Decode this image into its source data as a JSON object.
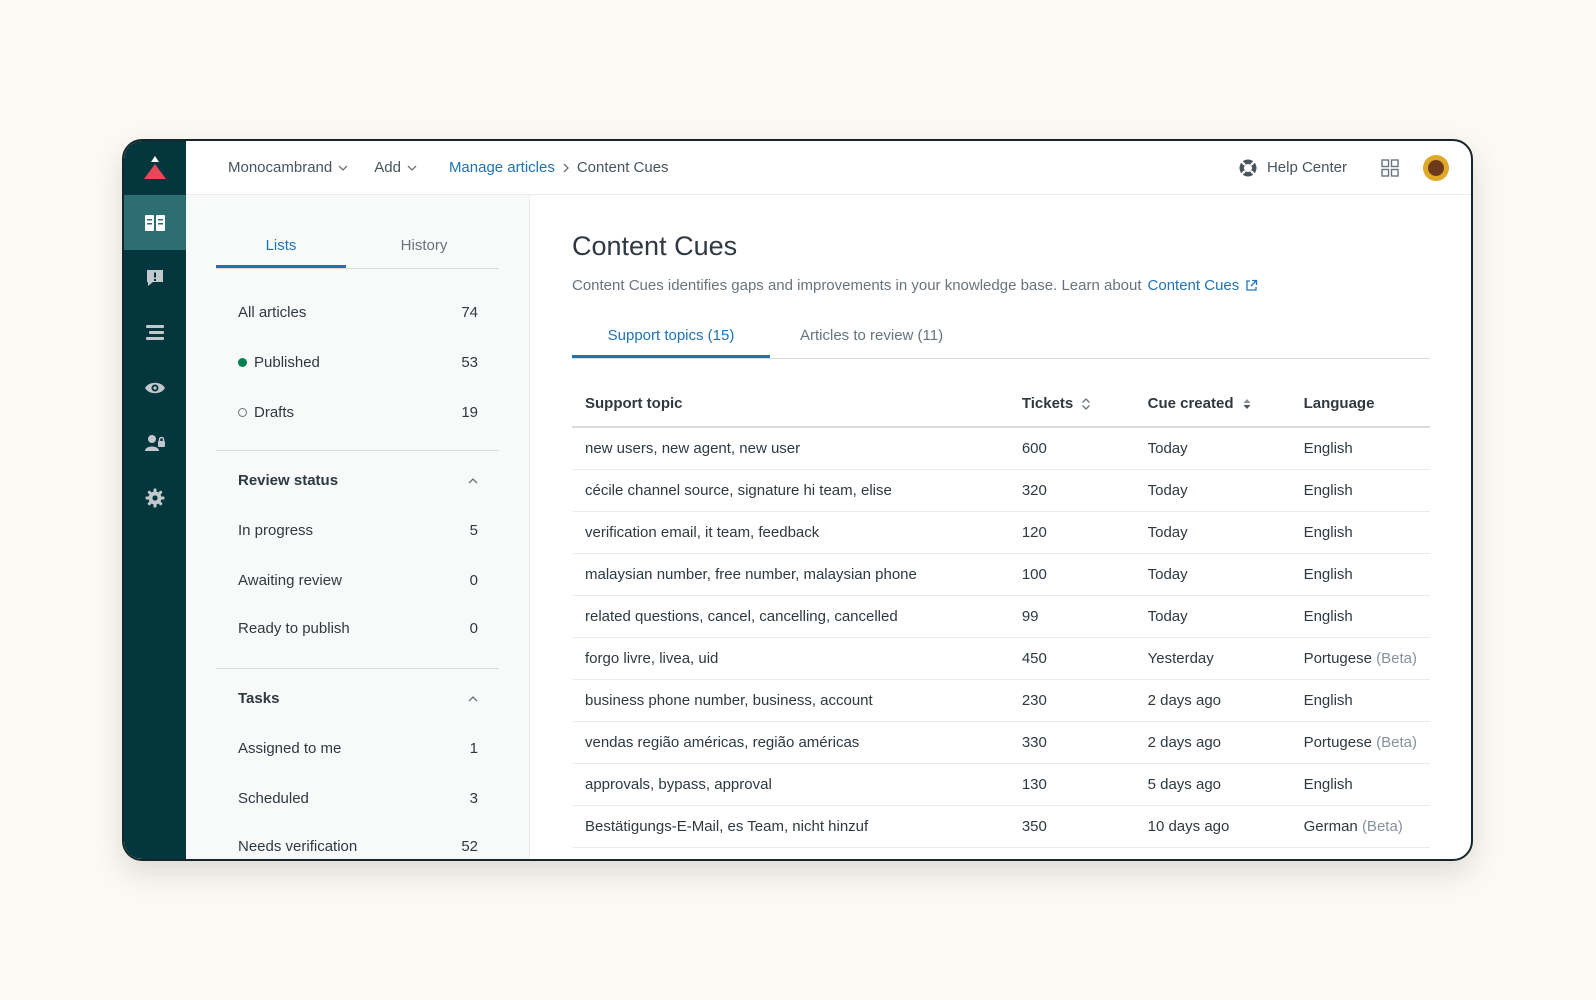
{
  "topbar": {
    "brand": "Monocambrand",
    "add": "Add",
    "crumb_link": "Manage articles",
    "crumb_current": "Content Cues",
    "help_center": "Help Center"
  },
  "rail": {
    "icons": [
      "guide-logo-icon",
      "knowledge-base-icon",
      "alert-icon",
      "list-icon",
      "eye-icon",
      "user-lock-icon",
      "gear-icon"
    ]
  },
  "sidepanel": {
    "tabs": [
      "Lists",
      "History"
    ],
    "lists": [
      {
        "label": "All articles",
        "count": "74"
      },
      {
        "label": "Published",
        "count": "53"
      },
      {
        "label": "Drafts",
        "count": "19"
      }
    ],
    "review_status": {
      "title": "Review status",
      "items": [
        {
          "label": "In progress",
          "count": "5"
        },
        {
          "label": "Awaiting review",
          "count": "0"
        },
        {
          "label": "Ready to publish",
          "count": "0"
        }
      ]
    },
    "tasks": {
      "title": "Tasks",
      "items": [
        {
          "label": "Assigned to me",
          "count": "1"
        },
        {
          "label": "Scheduled",
          "count": "3"
        },
        {
          "label": "Needs verification",
          "count": "52"
        }
      ]
    }
  },
  "main": {
    "title": "Content Cues",
    "description": "Content Cues identifies gaps and improvements in your knowledge base. Learn about",
    "description_link": "Content Cues",
    "tabs": [
      "Support topics (15)",
      "Articles to review (11)"
    ],
    "columns": [
      "Support topic",
      "Tickets",
      "Cue created",
      "Language"
    ],
    "rows": [
      {
        "topic": "new users, new agent, new user",
        "tickets": "600",
        "created": "Today",
        "language": "English",
        "beta": ""
      },
      {
        "topic": "cécile channel source, signature hi team, elise",
        "tickets": "320",
        "created": "Today",
        "language": "English",
        "beta": ""
      },
      {
        "topic": "verification email, it team, feedback",
        "tickets": "120",
        "created": "Today",
        "language": "English",
        "beta": ""
      },
      {
        "topic": "malaysian number, free number, malaysian phone",
        "tickets": "100",
        "created": "Today",
        "language": "English",
        "beta": ""
      },
      {
        "topic": "related questions, cancel, cancelling, cancelled",
        "tickets": "99",
        "created": "Today",
        "language": "English",
        "beta": ""
      },
      {
        "topic": "forgo livre, livea, uid",
        "tickets": "450",
        "created": "Yesterday",
        "language": "Portugese",
        "beta": "(Beta)"
      },
      {
        "topic": "business phone number, business, account",
        "tickets": "230",
        "created": "2 days ago",
        "language": "English",
        "beta": ""
      },
      {
        "topic": "vendas região américas, região américas",
        "tickets": "330",
        "created": "2 days ago",
        "language": "Portugese",
        "beta": "(Beta)"
      },
      {
        "topic": "approvals, bypass, approval",
        "tickets": "130",
        "created": "5 days ago",
        "language": "English",
        "beta": ""
      },
      {
        "topic": "Bestätigungs-E-Mail, es Team, nicht hinzuf",
        "tickets": "350",
        "created": "10 days ago",
        "language": "German",
        "beta": "(Beta)"
      }
    ]
  },
  "colors": {
    "rail": "#03363d",
    "rail_active": "#2d6e72",
    "accent": "#1f73b7",
    "published": "#038153",
    "logo": "#e9475a"
  }
}
